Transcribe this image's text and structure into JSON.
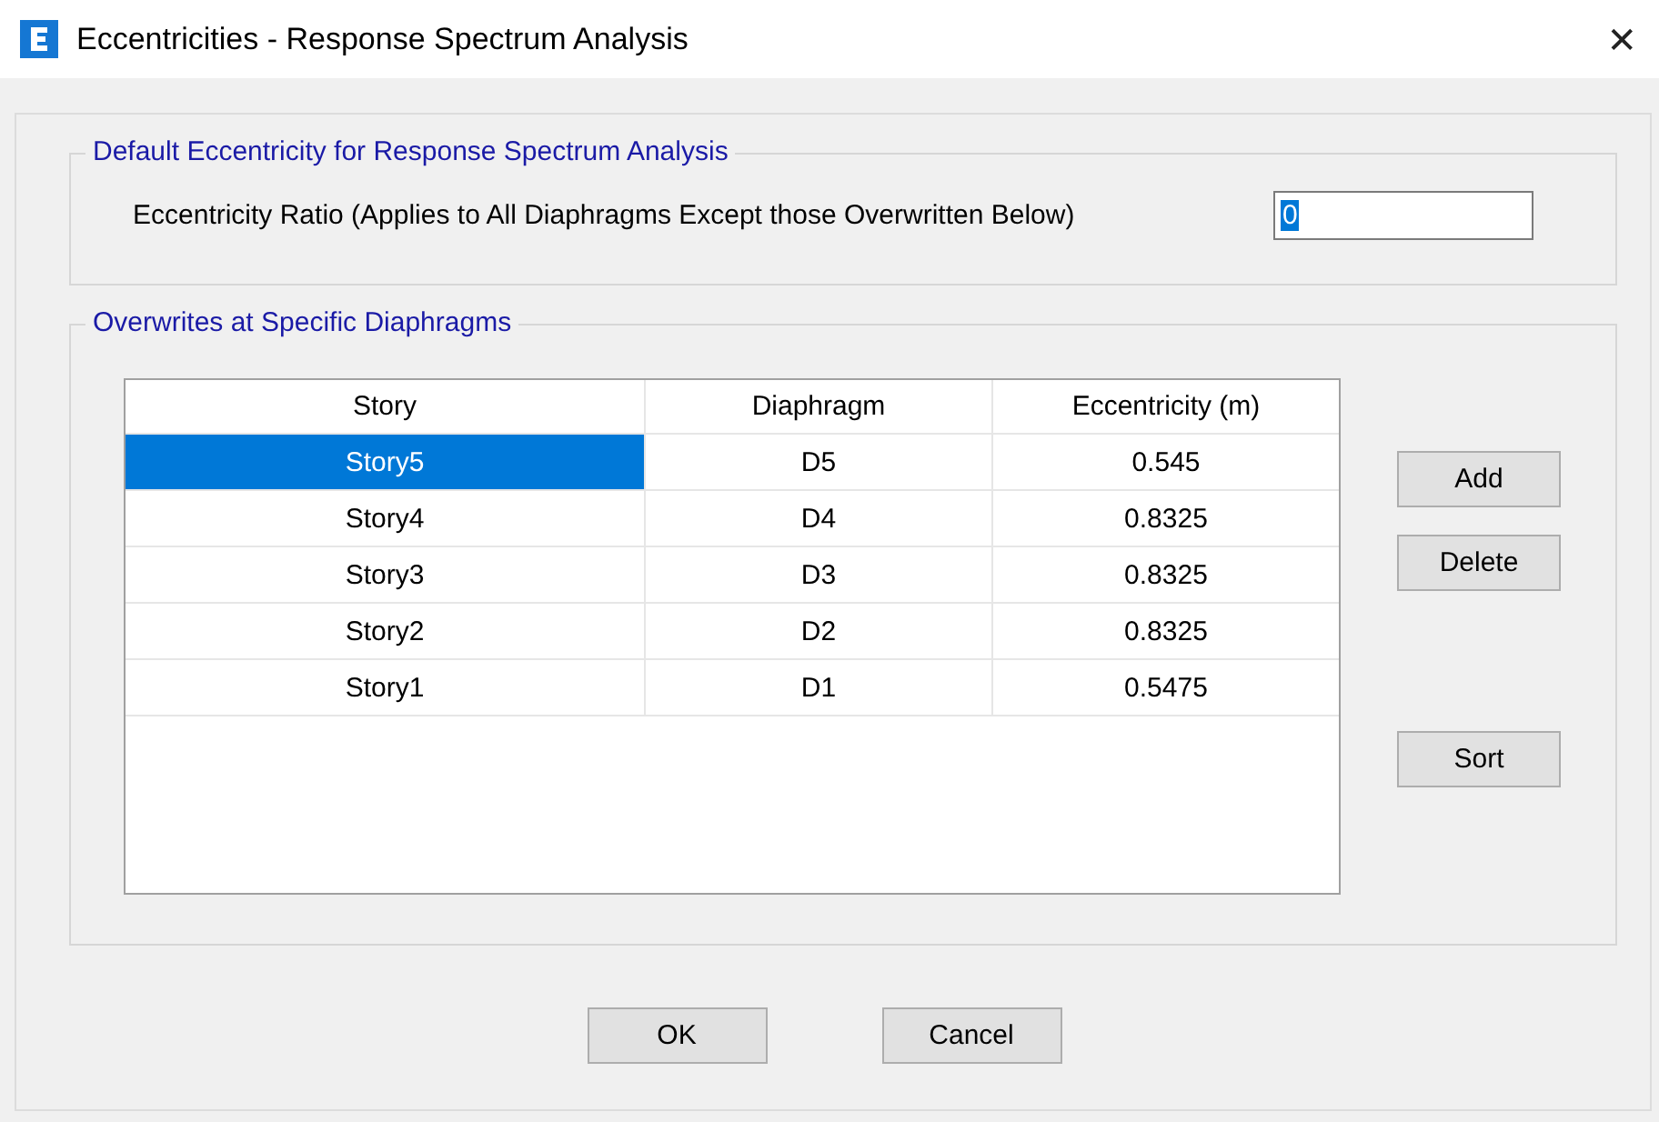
{
  "window": {
    "title": "Eccentricities - Response Spectrum Analysis",
    "close": "✕"
  },
  "default_group": {
    "legend": "Default Eccentricity for Response Spectrum Analysis",
    "label": "Eccentricity Ratio (Applies to All Diaphragms Except those Overwritten Below)",
    "field": {
      "value": "0",
      "text_selected": true
    }
  },
  "overwrites_group": {
    "legend": "Overwrites at Specific Diaphragms",
    "table": {
      "columns": [
        "Story",
        "Diaphragm",
        "Eccentricity (m)"
      ],
      "rows": [
        {
          "cells": [
            "Story5",
            "D5",
            "0.545"
          ],
          "selected": true
        },
        {
          "cells": [
            "Story4",
            "D4",
            "0.8325"
          ],
          "selected": false
        },
        {
          "cells": [
            "Story3",
            "D3",
            "0.8325"
          ],
          "selected": false
        },
        {
          "cells": [
            "Story2",
            "D2",
            "0.8325"
          ],
          "selected": false
        },
        {
          "cells": [
            "Story1",
            "D1",
            "0.5475"
          ],
          "selected": false
        }
      ]
    },
    "side_buttons": [
      "Add",
      "Delete",
      "Sort"
    ]
  },
  "buttons": [
    "OK",
    "Cancel"
  ]
}
